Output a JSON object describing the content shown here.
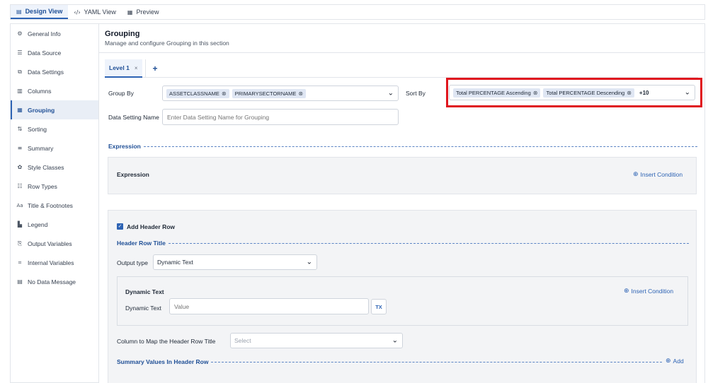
{
  "top_tabs": [
    {
      "label": "Design View",
      "icon": "layout-icon"
    },
    {
      "label": "YAML View",
      "icon": "code-icon"
    },
    {
      "label": "Preview",
      "icon": "preview-icon"
    }
  ],
  "sidebar": {
    "items": [
      {
        "label": "General Info",
        "icon": "gear-icon"
      },
      {
        "label": "Data Source",
        "icon": "database-icon"
      },
      {
        "label": "Data Settings",
        "icon": "data-settings-icon"
      },
      {
        "label": "Columns",
        "icon": "columns-icon"
      },
      {
        "label": "Grouping",
        "icon": "grouping-icon"
      },
      {
        "label": "Sorting",
        "icon": "sort-icon"
      },
      {
        "label": "Summary",
        "icon": "summary-icon"
      },
      {
        "label": "Style Classes",
        "icon": "palette-icon"
      },
      {
        "label": "Row Types",
        "icon": "row-types-icon"
      },
      {
        "label": "Title & Footnotes",
        "icon": "text-icon"
      },
      {
        "label": "Legend",
        "icon": "legend-icon"
      },
      {
        "label": "Output Variables",
        "icon": "output-icon"
      },
      {
        "label": "Internal Variables",
        "icon": "variable-icon"
      },
      {
        "label": "No Data Message",
        "icon": "message-icon"
      }
    ]
  },
  "main": {
    "title": "Grouping",
    "subtitle": "Manage and configure Grouping in this section",
    "level_tab": {
      "label": "Level 1",
      "close": "×",
      "add": "+"
    },
    "group_by": {
      "label": "Group By",
      "chips": [
        "ASSETCLASSNAME",
        "PRIMARYSECTORNAME"
      ]
    },
    "sort_by": {
      "label": "Sort By",
      "chips": [
        "Total PERCENTAGE Ascending",
        "Total PERCENTAGE Descending"
      ],
      "more": "+10"
    },
    "data_setting_name": {
      "label": "Data Setting Name",
      "placeholder": "Enter Data Setting Name for Grouping"
    },
    "expression_section": "Expression",
    "expression_panel": {
      "title": "Expression",
      "insert": "Insert Condition"
    },
    "header_row": {
      "checkbox_label": "Add Header Row",
      "section_title": "Header Row Title",
      "output_type_label": "Output type",
      "output_type_value": "Dynamic Text",
      "dynamic_text_panel_title": "Dynamic Text",
      "insert": "Insert Condition",
      "dynamic_text_label": "Dynamic Text",
      "dynamic_text_placeholder": "Value",
      "tx_label": "TX",
      "map_column_label": "Column to Map the Header Row Title",
      "map_column_placeholder": "Select",
      "summary_section": "Summary Values In Header Row",
      "add_label": "Add"
    }
  },
  "colors": {
    "accent": "#2d63b4",
    "highlight": "#e0161e"
  }
}
